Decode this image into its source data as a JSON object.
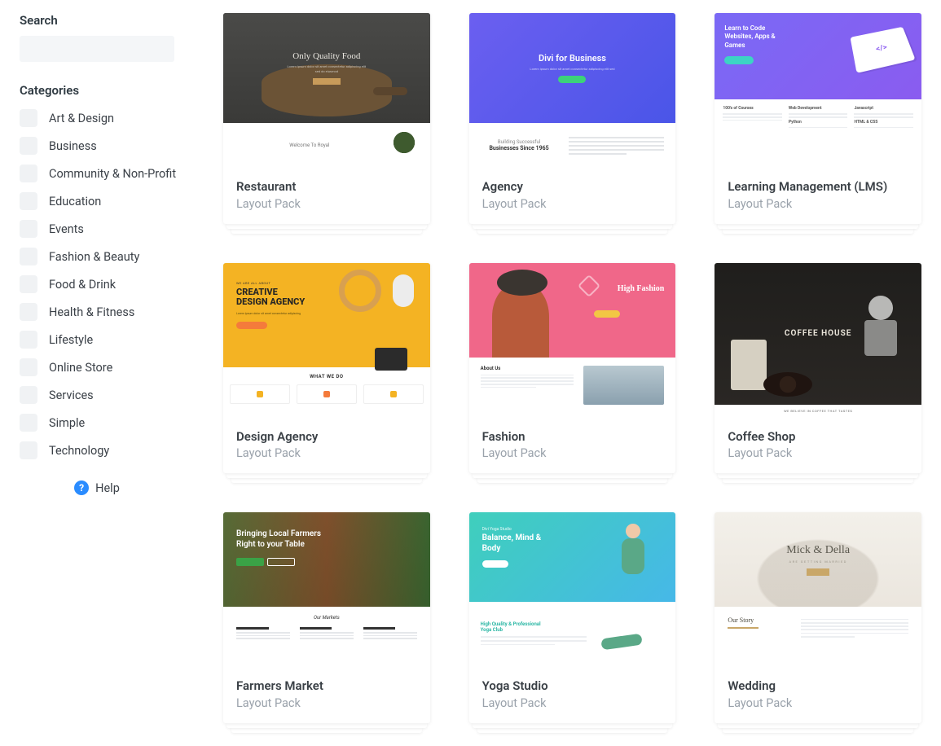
{
  "sidebar": {
    "search_label": "Search",
    "categories_label": "Categories",
    "categories": [
      "Art & Design",
      "Business",
      "Community & Non-Profit",
      "Education",
      "Events",
      "Fashion & Beauty",
      "Food & Drink",
      "Health & Fitness",
      "Lifestyle",
      "Online Store",
      "Services",
      "Simple",
      "Technology"
    ],
    "help_label": "Help"
  },
  "cards": [
    {
      "title": "Restaurant",
      "subtitle": "Layout Pack"
    },
    {
      "title": "Agency",
      "subtitle": "Layout Pack"
    },
    {
      "title": "Learning Management (LMS)",
      "subtitle": "Layout Pack"
    },
    {
      "title": "Design Agency",
      "subtitle": "Layout Pack"
    },
    {
      "title": "Fashion",
      "subtitle": "Layout Pack"
    },
    {
      "title": "Coffee Shop",
      "subtitle": "Layout Pack"
    },
    {
      "title": "Farmers Market",
      "subtitle": "Layout Pack"
    },
    {
      "title": "Yoga Studio",
      "subtitle": "Layout Pack"
    },
    {
      "title": "Wedding",
      "subtitle": "Layout Pack"
    }
  ],
  "thumbs": {
    "restaurant": {
      "heading": "Only Quality Food",
      "welcome": "Welcome To Royal"
    },
    "agency": {
      "heading": "Divi for Business",
      "sub1": "Building Successful",
      "sub2": "Businesses Since 1965"
    },
    "lms": {
      "heading": "Learn to Code Websites, Apps & Games",
      "col1": "100's of Courses",
      "col2": "Web Development",
      "col3": "Javascript",
      "col4": "Python",
      "col5": "HTML & CSS"
    },
    "design": {
      "tag": "WE ARE ALL ABOUT",
      "heading1": "CREATIVE",
      "heading2": "DESIGN AGENCY",
      "what": "WHAT WE DO"
    },
    "fashion": {
      "heading": "High Fashion",
      "about": "About Us"
    },
    "coffee": {
      "heading": "COFFEE HOUSE",
      "sub": "WE BELIEVE IN COFFEE THAT TASTES"
    },
    "farmers": {
      "heading": "Bringing Local Farmers Right to your Table",
      "markets": "Our Markets"
    },
    "yoga": {
      "tag": "Divi Yoga Studio",
      "heading": "Balance, Mind & Body",
      "sub": "High Quality & Professional Yoga Club"
    },
    "wedding": {
      "heading": "Mick & Della",
      "sub": "ARE GETTING MARRIED",
      "story": "Our Story"
    }
  }
}
